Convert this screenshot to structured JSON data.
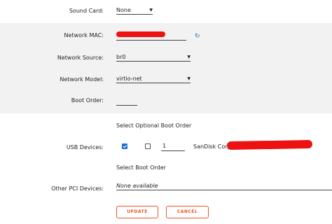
{
  "sound_card": {
    "label": "Sound Card:",
    "value": "None"
  },
  "network_mac": {
    "label": "Network MAC:"
  },
  "network_source": {
    "label": "Network Source:",
    "value": "br0"
  },
  "network_model": {
    "label": "Network Model:",
    "value": "virtio-net"
  },
  "boot_order": {
    "label": "Boot Order:"
  },
  "usb": {
    "header": "Select  Optional  Boot Order",
    "label": "USB Devices:",
    "device": {
      "selected": true,
      "optional": false,
      "boot_order": "1",
      "name": "SanDisk Corp."
    }
  },
  "pci": {
    "header": "Select  Boot Order",
    "label": "Other PCI Devices:",
    "value": "None available"
  },
  "buttons": {
    "update": "UPDATE",
    "cancel": "CANCEL"
  },
  "colors": {
    "accent": "#e8552a",
    "redaction": "#ee1111",
    "refresh": "#1a73c8"
  }
}
